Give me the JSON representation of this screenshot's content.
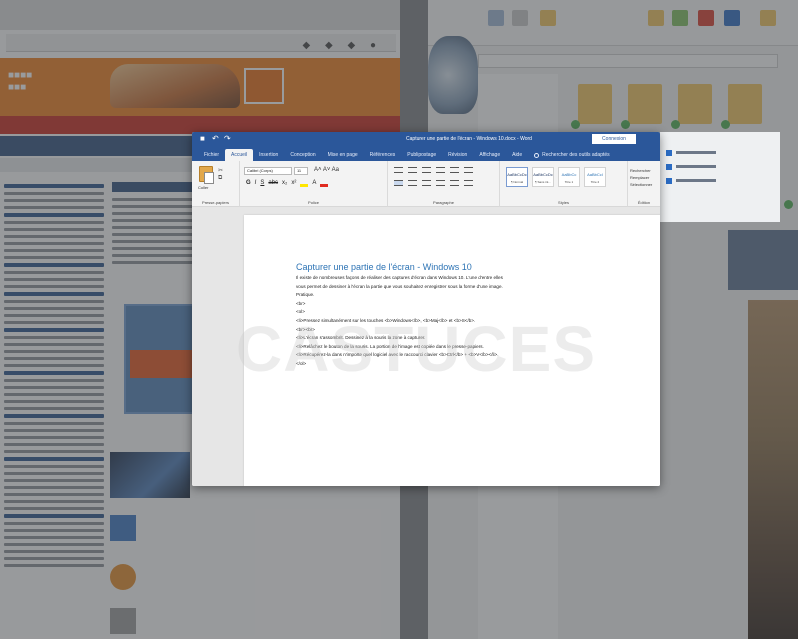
{
  "word": {
    "title": "Capturer une partie de l'écran - Windows 10.docx - Word",
    "connect_label": "Connexion",
    "quick_access": [
      "save",
      "undo",
      "redo"
    ],
    "tabs": [
      {
        "label": "Fichier"
      },
      {
        "label": "Accueil",
        "active": true
      },
      {
        "label": "Insertion"
      },
      {
        "label": "Conception"
      },
      {
        "label": "Mise en page"
      },
      {
        "label": "Références"
      },
      {
        "label": "Publipostage"
      },
      {
        "label": "Révision"
      },
      {
        "label": "Affichage"
      },
      {
        "label": "Aide"
      }
    ],
    "tell_me": "Rechercher des outils adaptés",
    "ribbon": {
      "clipboard": {
        "paste_label": "Coller",
        "group_label": "Presse-papiers"
      },
      "font": {
        "font_name": "Calibri (Corps)",
        "font_size": "11",
        "group_label": "Police",
        "buttons": [
          "G",
          "I",
          "S",
          "abc",
          "x₂",
          "x²",
          "A"
        ]
      },
      "paragraph": {
        "group_label": "Paragraphe"
      },
      "styles": {
        "group_label": "Styles",
        "items": [
          {
            "sample": "AaBbCcDc",
            "name": "¶ Normal"
          },
          {
            "sample": "AaBbCcDc",
            "name": "¶ Sans int..."
          },
          {
            "sample": "AaBbCc",
            "name": "Titre 1"
          },
          {
            "sample": "AaBbCcI",
            "name": "Titre 2"
          }
        ]
      },
      "editing": {
        "items": [
          "Rechercher",
          "Remplacer",
          "Sélectionner"
        ],
        "group_label": "Édition"
      }
    },
    "document": {
      "heading": "Capturer une partie de l'écran - Windows 10",
      "lines": [
        "Il existe de nombreuses façons de réaliser des captures d'écran dans Windows 10. L'une d'entre elles",
        "vous permet de dessiner à l'écran la partie que vous souhaitez enregistrer sous la forme d'une image.",
        "Pratique.",
        "<br>",
        "<ol>",
        "<li>Pressez simultanément sur les touches <b>Windows</b>, <b>Maj</b> et <b>S</b>.",
        "<br><br>",
        "<li>L'écran s'assombrit. Dessinez à la souris la zone à capturer.",
        "<li>Relâchez le bouton de la souris. La portion de l'image est copiée dans le presse-papiers.",
        "<li>Récupérez-la dans n'importe quel logiciel avec le raccourci clavier <b>Ctrl</b> + <b>V</b></li>.",
        "</ol>"
      ]
    }
  },
  "watermark": "CASTUCES",
  "colors": {
    "word_blue": "#2b579a",
    "heading_blue": "#2e74b5",
    "dim_overlay": "#46484c"
  }
}
